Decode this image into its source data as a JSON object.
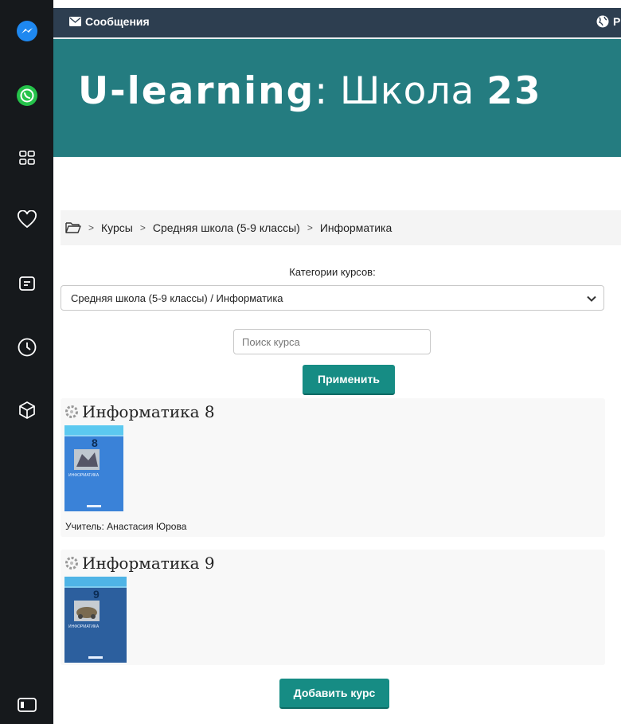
{
  "topbar": {
    "messages_label": "Сообщения",
    "lang_label": "Р"
  },
  "header": {
    "title_brand": "U-learning",
    "title_rest": ": Школа ",
    "title_number": "23"
  },
  "breadcrumb": {
    "items": [
      "Курсы",
      "Средняя школа (5-9 классы)",
      "Информатика"
    ]
  },
  "category": {
    "label": "Категории курсов:",
    "selected": "Средняя школа (5-9 классы) / Информатика"
  },
  "search": {
    "placeholder": "Поиск курса",
    "value": ""
  },
  "apply_button": "Применить",
  "courses": [
    {
      "title": "Информатика 8",
      "cover_number": "8",
      "cover_text": "ИНФОРМАТИКА",
      "teacher": "Учитель: Анастасия Юрова",
      "cover_color": "#3a82d8"
    },
    {
      "title": "Информатика 9",
      "cover_number": "9",
      "cover_text": "ИНФОРМАТИКА",
      "teacher": "",
      "cover_color": "#2c5f9e"
    }
  ],
  "add_course_button": "Добавить курс",
  "colors": {
    "sidebar": "#16191c",
    "topbar": "#2d3e50",
    "header": "#247c80",
    "accent": "#168c84"
  },
  "sidebar_icons": [
    "messenger-icon",
    "whatsapp-icon",
    "apps-grid-icon",
    "heart-icon",
    "news-icon",
    "clock-icon",
    "cube-icon",
    "panel-toggle-icon"
  ]
}
